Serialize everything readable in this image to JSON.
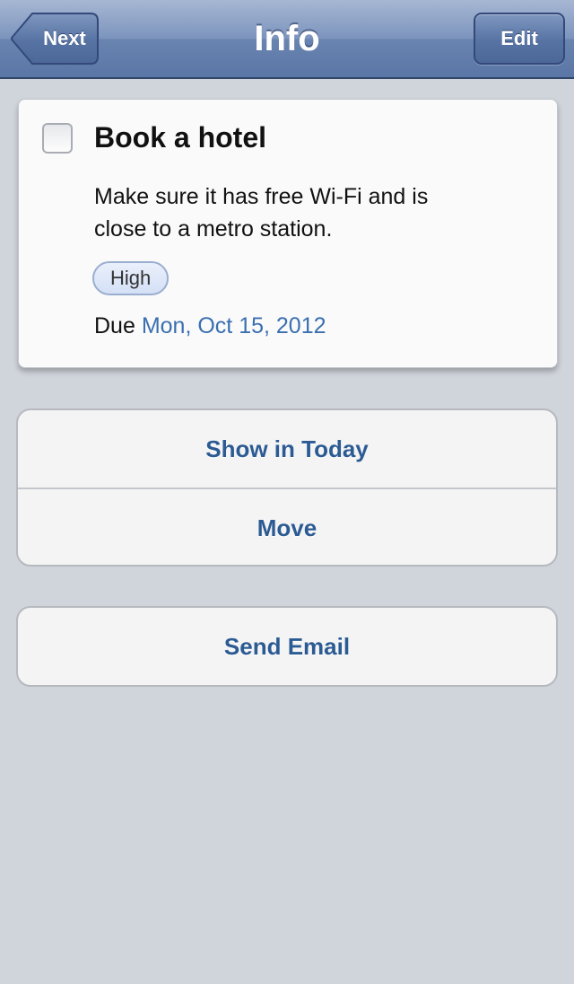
{
  "navbar": {
    "title": "Info",
    "back_label": "Next",
    "edit_label": "Edit"
  },
  "task": {
    "title": "Book a hotel",
    "notes_line1": "Make sure it has free Wi-Fi and is",
    "notes_line2": "close to a metro station.",
    "priority": "High",
    "due_label": "Due",
    "due_date": "Mon, Oct 15, 2012",
    "completed": false
  },
  "actions": {
    "group1": [
      "Show in Today",
      "Move"
    ],
    "group2": [
      "Send Email"
    ]
  },
  "colors": {
    "nav_bar": "#6a84b0",
    "link_text": "#2c5b93",
    "date_text": "#3a6fb0",
    "background": "#d0d4db"
  },
  "icons": {
    "back": "back-arrow-button",
    "checkbox": "checkbox-icon"
  }
}
